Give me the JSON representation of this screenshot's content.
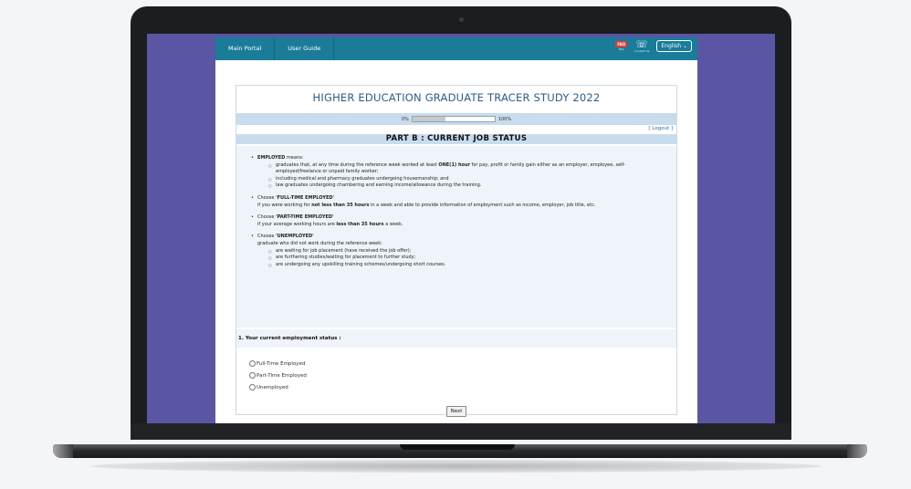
{
  "nav": {
    "main_portal": "Main Portal",
    "user_guide": "User Guide",
    "faq_badge": "FAQ",
    "faq_label": "FAQ",
    "contact_label": "Contact Us",
    "language": "English",
    "language_chevron": "⌄"
  },
  "survey": {
    "title": "HIGHER EDUCATION GRADUATE TRACER STUDY 2022",
    "progress_start": "0%",
    "progress_end": "100%",
    "progress_value": 0.4,
    "logout": "[ Logout ]",
    "part_title": "PART B : CURRENT JOB STATUS"
  },
  "info": {
    "employed_term": "EMPLOYED",
    "employed_suffix": " means:",
    "employed_sub1_a": "graduates that, at any time during the reference week worked at least ",
    "employed_sub1_b": "ONE(1) hour",
    "employed_sub1_c": " for pay, profit or family gain either as an employer, employee, self-employed/freelance or unpaid family worker;",
    "employed_sub2": "including medical and pharmacy graduates undergoing housemanship; and",
    "employed_sub3": "law graduates undergoing chambering and earning income/allowance during the training.",
    "choose": "Choose ",
    "fulltime_term": "'FULL-TIME EMPLOYED'",
    "fulltime_a": "if you were working for ",
    "fulltime_b": "not less than 35 hours",
    "fulltime_c": " in a week and able to provide information of employment such as income, employer, job title, etc.",
    "parttime_term": "'PART-TIME EMPLOYED'",
    "parttime_a": "if your average working hours are ",
    "parttime_b": "less than 35 hours",
    "parttime_c": " a week.",
    "unemployed_term": "'UNEMPLOYED'",
    "unemployed_intro": "graduate who did not work during the reference week:",
    "unemployed_sub1": "are waiting for job placement (have received the job offer);",
    "unemployed_sub2": "are furthering studies/waiting for placement to further study;",
    "unemployed_sub3": "are undergoing any upskilling training schemes/undergoing short courses."
  },
  "question": {
    "label": "1. Your current employment status :",
    "options": [
      "Full-Time Employed",
      "Part-Time Employed",
      "Unemployed"
    ]
  },
  "next_label": "Next"
}
